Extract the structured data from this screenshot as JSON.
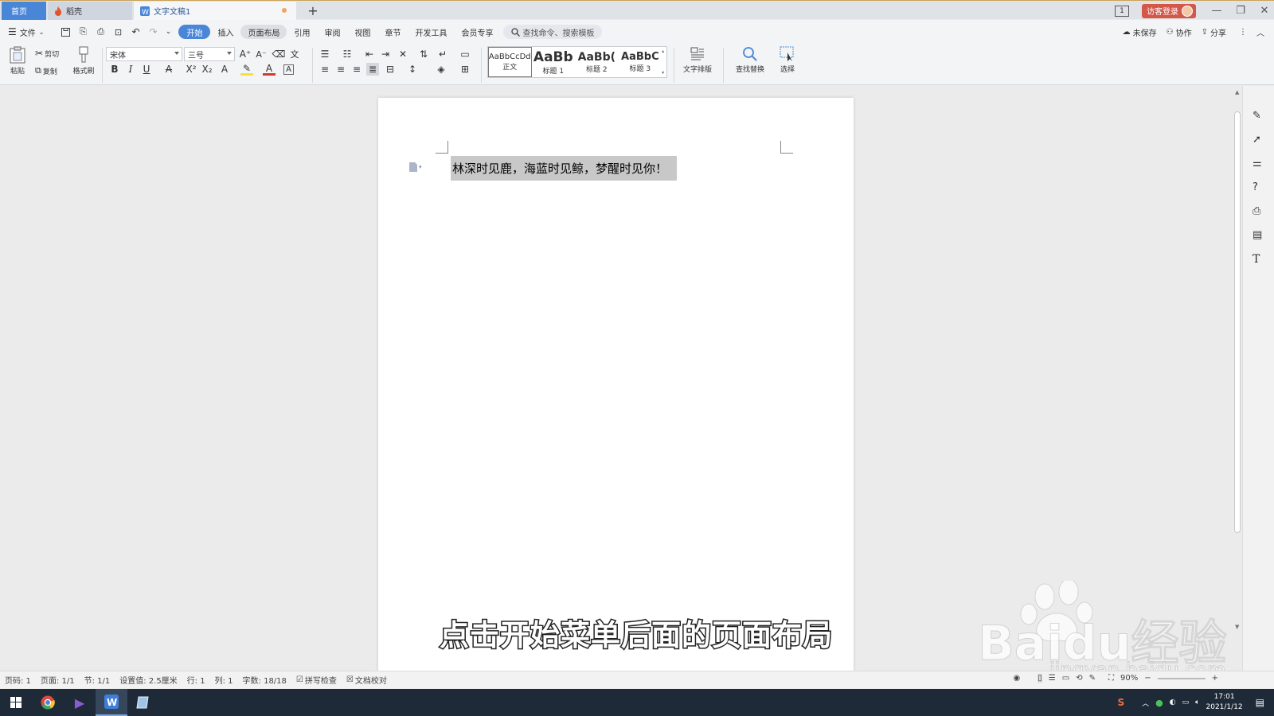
{
  "titlebar": {
    "tabs": [
      {
        "label": "首页"
      },
      {
        "label": "稻壳"
      },
      {
        "label": "文字文稿1"
      }
    ],
    "new_tab": "+",
    "page_badge": "1",
    "login": "访客登录"
  },
  "menubar": {
    "items": [
      "文件",
      "开始",
      "插入",
      "页面布局",
      "引用",
      "审阅",
      "视图",
      "章节",
      "开发工具",
      "会员专享"
    ],
    "search_placeholder": "查找命令、搜索模板",
    "right": {
      "unsaved": "未保存",
      "collab": "协作",
      "share": "分享"
    }
  },
  "ribbon": {
    "paste": "粘贴",
    "cut": "剪切",
    "copy": "复制",
    "format_painter": "格式刷",
    "font_name": "宋体",
    "font_size": "三号",
    "styles": [
      {
        "preview": "AaBbCcDd",
        "label": "正文"
      },
      {
        "preview": "AaBb",
        "label": "标题 1"
      },
      {
        "preview": "AaBb(",
        "label": "标题 2"
      },
      {
        "preview": "AaBbC",
        "label": "标题 3"
      }
    ],
    "text_layout": "文字排版",
    "find_replace": "查找替换",
    "select": "选择"
  },
  "document": {
    "text": "林深时见鹿，海蓝时见鲸，梦醒时见你！"
  },
  "subtitle": "点击开始菜单后面的页面布局",
  "watermark": {
    "text": "Baidu经验",
    "url": "jingyan.baidu.com"
  },
  "statusbar": {
    "page_code": "页码: 1",
    "page": "页面: 1/1",
    "section": "节: 1/1",
    "setting": "设置值: 2.5厘米",
    "row": "行: 1",
    "col": "列: 1",
    "word_count": "字数: 18/18",
    "spell_check": "拼写检查",
    "proof": "文档校对",
    "zoom": "90%"
  },
  "taskbar": {
    "time": "17:01",
    "date": "2021/1/12"
  },
  "colors": {
    "accent": "#4a86d8",
    "login": "#d4584a",
    "taskbar": "#1f2a38"
  }
}
